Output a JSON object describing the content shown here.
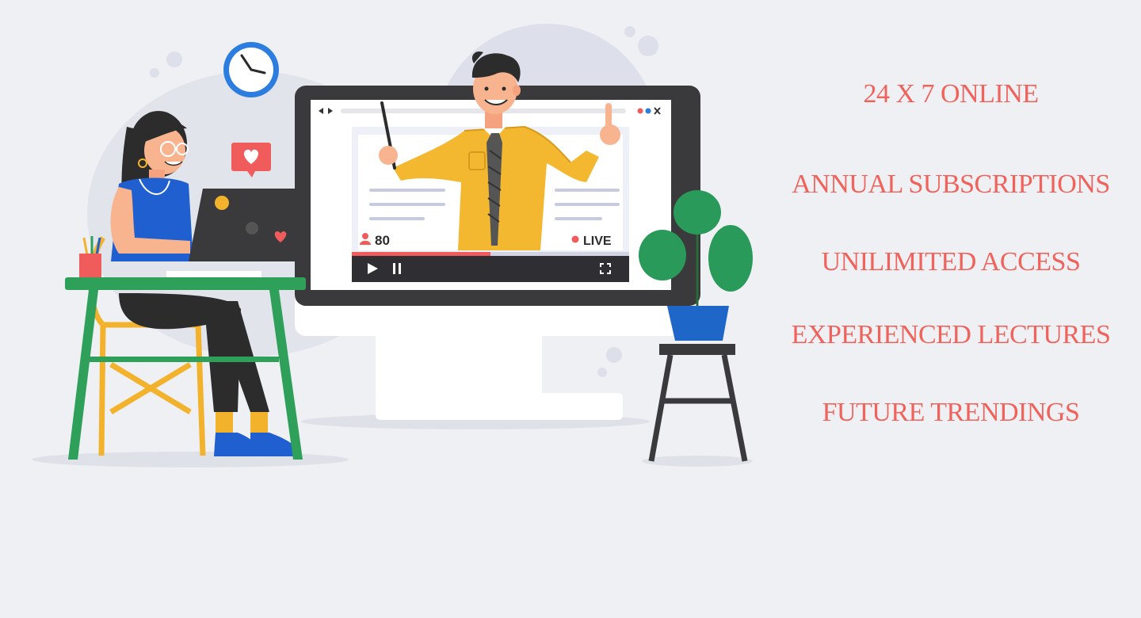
{
  "video_player": {
    "viewer_count": "80",
    "live_label": "LIVE",
    "progress": 0.5
  },
  "features": [
    "24 X 7 ONLINE",
    "ANNUAL SUBSCRIPTIONS",
    "UNILIMITED ACCESS",
    "EXPERIENCED LECTURES",
    "FUTURE TRENDINGS"
  ],
  "colors": {
    "background": "#eef0f4",
    "accent": "#f0625a",
    "monitor_frame": "#3a3a3d",
    "teacher_shirt": "#f4b830",
    "desk": "#2fa05a",
    "chair": "#f2b22c",
    "plant": "#2a9a5a",
    "pot": "#1e66c8"
  }
}
